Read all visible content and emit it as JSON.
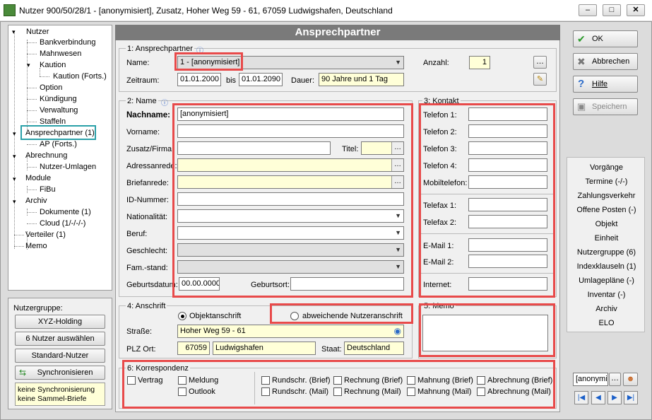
{
  "window": {
    "title": "Nutzer 900/50/28/1 - [anonymisiert], Zusatz, Hoher Weg 59 - 61, 67059 Ludwigshafen, Deutschland"
  },
  "tree": {
    "items": [
      "Nutzer",
      "Bankverbindung",
      "Mahnwesen",
      "Kaution",
      "Kaution (Forts.)",
      "Option",
      "Kündigung",
      "Verwaltung",
      "Staffeln",
      "Ansprechpartner (1)",
      "AP (Forts.)",
      "Abrechnung",
      "Nutzer-Umlagen",
      "Module",
      "FiBu",
      "Archiv",
      "Dokumente (1)",
      "Cloud (1/-/-/-)",
      "Verteiler (1)",
      "Memo"
    ]
  },
  "nutzergruppe": {
    "label": "Nutzergruppe:",
    "b1": "XYZ-Holding",
    "b2": "6 Nutzer auswählen",
    "b3": "Standard-Nutzer",
    "b4": "Synchronisieren",
    "note1": "keine Synchronisierung",
    "note2": "keine Sammel-Briefe"
  },
  "header": "Ansprechpartner",
  "sec1": {
    "title": "1: Ansprechpartner",
    "name_label": "Name:",
    "name_value": "1 - [anonymisiert]",
    "zeitraum_label": "Zeitraum:",
    "von": "01.01.2000",
    "bis_label": "bis",
    "bis": "01.01.2090",
    "dauer_label": "Dauer:",
    "dauer": "90 Jahre und 1 Tag",
    "anzahl_label": "Anzahl:",
    "anzahl": "1"
  },
  "sec2": {
    "title": "2: Name",
    "nachname_label": "Nachname:",
    "nachname": "[anonymisiert]",
    "vorname_label": "Vorname:",
    "zusatz_label": "Zusatz/Firma:",
    "titel_label": "Titel:",
    "adressanrede_label": "Adressanrede:",
    "briefanrede_label": "Briefanrede:",
    "id_label": "ID-Nummer:",
    "nationalitaet_label": "Nationalität:",
    "beruf_label": "Beruf:",
    "geschlecht_label": "Geschlecht:",
    "famstand_label": "Fam.-stand:",
    "geburtsdatum_label": "Geburtsdatum:",
    "geburtsdatum": "00.00.0000",
    "geburtsort_label": "Geburtsort:"
  },
  "sec3": {
    "title": "3: Kontakt",
    "t1": "Telefon 1:",
    "t2": "Telefon 2:",
    "t3": "Telefon 3:",
    "t4": "Telefon 4:",
    "mobil": "Mobiltelefon:",
    "fax1": "Telefax 1:",
    "fax2": "Telefax 2:",
    "mail1": "E-Mail 1:",
    "mail2": "E-Mail 2:",
    "internet": "Internet:"
  },
  "sec4": {
    "title": "4: Anschrift",
    "opt1": "Objektanschrift",
    "opt2": "abweichende Nutzeranschrift",
    "strasse_label": "Straße:",
    "strasse": "Hoher Weg 59 - 61",
    "plz_label": "PLZ Ort:",
    "plz": "67059",
    "ort": "Ludwigshafen",
    "staat_label": "Staat:",
    "staat": "Deutschland"
  },
  "sec5": {
    "title": "5: Memo"
  },
  "sec6": {
    "title": "6: Korrespondenz",
    "vertrag": "Vertrag",
    "meldung": "Meldung",
    "outlook": "Outlook",
    "rb": "Rundschr. (Brief)",
    "rm": "Rundschr. (Mail)",
    "reb": "Rechnung (Brief)",
    "rem": "Rechnung (Mail)",
    "mb": "Mahnung (Brief)",
    "mm": "Mahnung (Mail)",
    "ab": "Abrechnung (Brief)",
    "am": "Abrechnung (Mail)"
  },
  "actions": {
    "ok": "OK",
    "abbrechen": "Abbrechen",
    "hilfe": "Hilfe",
    "speichern": "Speichern"
  },
  "links": [
    "Vorgänge",
    "Termine (-/-)",
    "Zahlungsverkehr",
    "Offene Posten (-)",
    "Objekt",
    "Einheit",
    "Nutzergruppe (6)",
    "Indexklauseln (1)",
    "Umlagepläne (-)",
    "Inventar (-)",
    "Archiv",
    "ELO"
  ],
  "search": {
    "value": "[anonymi"
  },
  "colors": {
    "highlight": "#e84a4a",
    "teal": "#2aa0a8",
    "header": "#7a7a7a",
    "yellow": "#ffffd8"
  }
}
